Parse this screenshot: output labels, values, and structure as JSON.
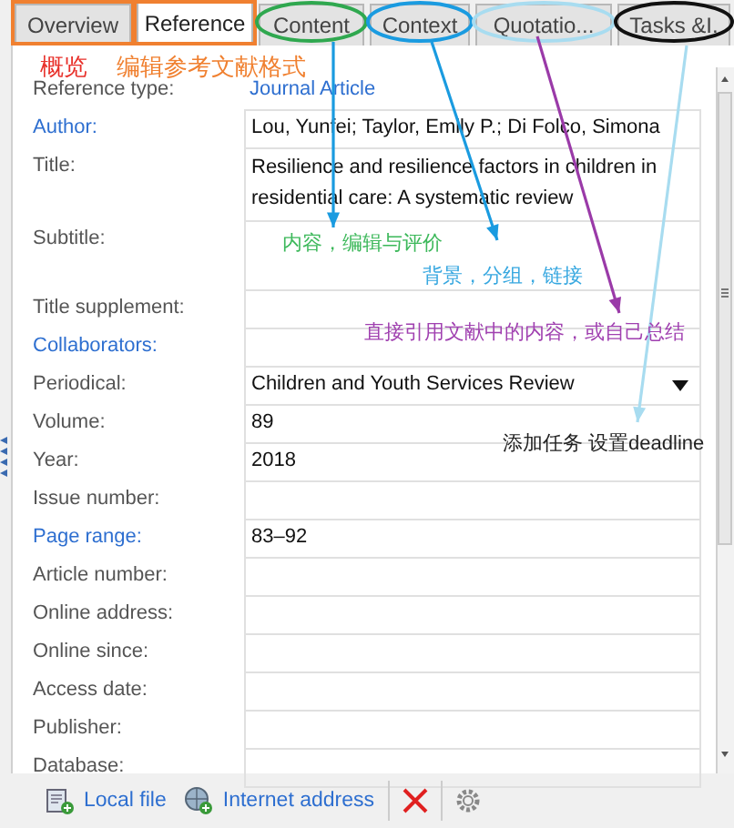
{
  "tabs": [
    {
      "label": "Overview",
      "selected": false,
      "highlight": {
        "kind": "frame",
        "color": "#f08030"
      }
    },
    {
      "label": "Reference",
      "selected": true,
      "highlight": {
        "kind": "frame",
        "color": "#f08030"
      }
    },
    {
      "label": "Content",
      "selected": false,
      "highlight": {
        "kind": "ellipse",
        "color": "#2fa84f"
      }
    },
    {
      "label": "Context",
      "selected": false,
      "highlight": {
        "kind": "ellipse",
        "color": "#1a9be0"
      }
    },
    {
      "label": "Quotatio...",
      "selected": false,
      "highlight": {
        "kind": "ellipse",
        "color": "#a8dcf0"
      }
    },
    {
      "label": "Tasks &I.",
      "selected": false,
      "highlight": {
        "kind": "ellipse",
        "color": "#111111"
      }
    }
  ],
  "fields": [
    {
      "label": "Reference type:",
      "kind": "link-value",
      "linked": false,
      "value": "Journal Article"
    },
    {
      "label": "Author:",
      "kind": "text",
      "linked": true,
      "value": "Lou, Yunfei; Taylor, Emily P.; Di Folco, Simona"
    },
    {
      "label": "Title:",
      "kind": "multiline",
      "linked": false,
      "value": "Resilience and resilience factors in children in residential care: A systematic review"
    },
    {
      "label": "Subtitle:",
      "kind": "multiline",
      "linked": false
    },
    {
      "label": "Title supplement:",
      "kind": "text",
      "linked": false
    },
    {
      "label": "Collaborators:",
      "kind": "text",
      "linked": true
    },
    {
      "label": "Periodical:",
      "kind": "dropdown",
      "linked": false,
      "value": "Children and Youth Services Review"
    },
    {
      "label": "Volume:",
      "kind": "text",
      "linked": false,
      "value": "89"
    },
    {
      "label": "Year:",
      "kind": "text",
      "linked": false,
      "value": "2018"
    },
    {
      "label": "Issue number:",
      "kind": "text",
      "linked": false
    },
    {
      "label": "Page range:",
      "kind": "text",
      "linked": true,
      "value": "83–92"
    },
    {
      "label": "Article number:",
      "kind": "text",
      "linked": false
    },
    {
      "label": "Online address:",
      "kind": "text",
      "linked": false
    },
    {
      "label": "Online since:",
      "kind": "text",
      "linked": false
    },
    {
      "label": "Access date:",
      "kind": "text",
      "linked": false
    },
    {
      "label": "Publisher:",
      "kind": "text",
      "linked": false
    },
    {
      "label": "Database:",
      "kind": "text",
      "linked": false
    }
  ],
  "toolbar": [
    {
      "kind": "local-file",
      "label": "Local file"
    },
    {
      "kind": "internet-address",
      "label": "Internet address"
    },
    {
      "kind": "delete"
    },
    {
      "kind": "settings"
    }
  ],
  "notes": [
    {
      "text": "概览",
      "color": "#e8302a"
    },
    {
      "text": "编辑参考文献格式",
      "color": "#f08030"
    },
    {
      "text": "内容，编辑与评价",
      "color": "#3cb85a",
      "arrow": {
        "color": "#1a9be0"
      }
    },
    {
      "text": "背景，分组，链接",
      "color": "#38a8e0",
      "arrow": {
        "color": "#1a9be0"
      }
    },
    {
      "text": "直接引用文献中的内容，或自己总结",
      "color": "#a040b0",
      "arrow": {
        "color": "#9a3aa8"
      }
    },
    {
      "text": "添加任务 设置deadline",
      "color": "#222222",
      "arrow": {
        "color": "#a8dcf0"
      }
    }
  ]
}
